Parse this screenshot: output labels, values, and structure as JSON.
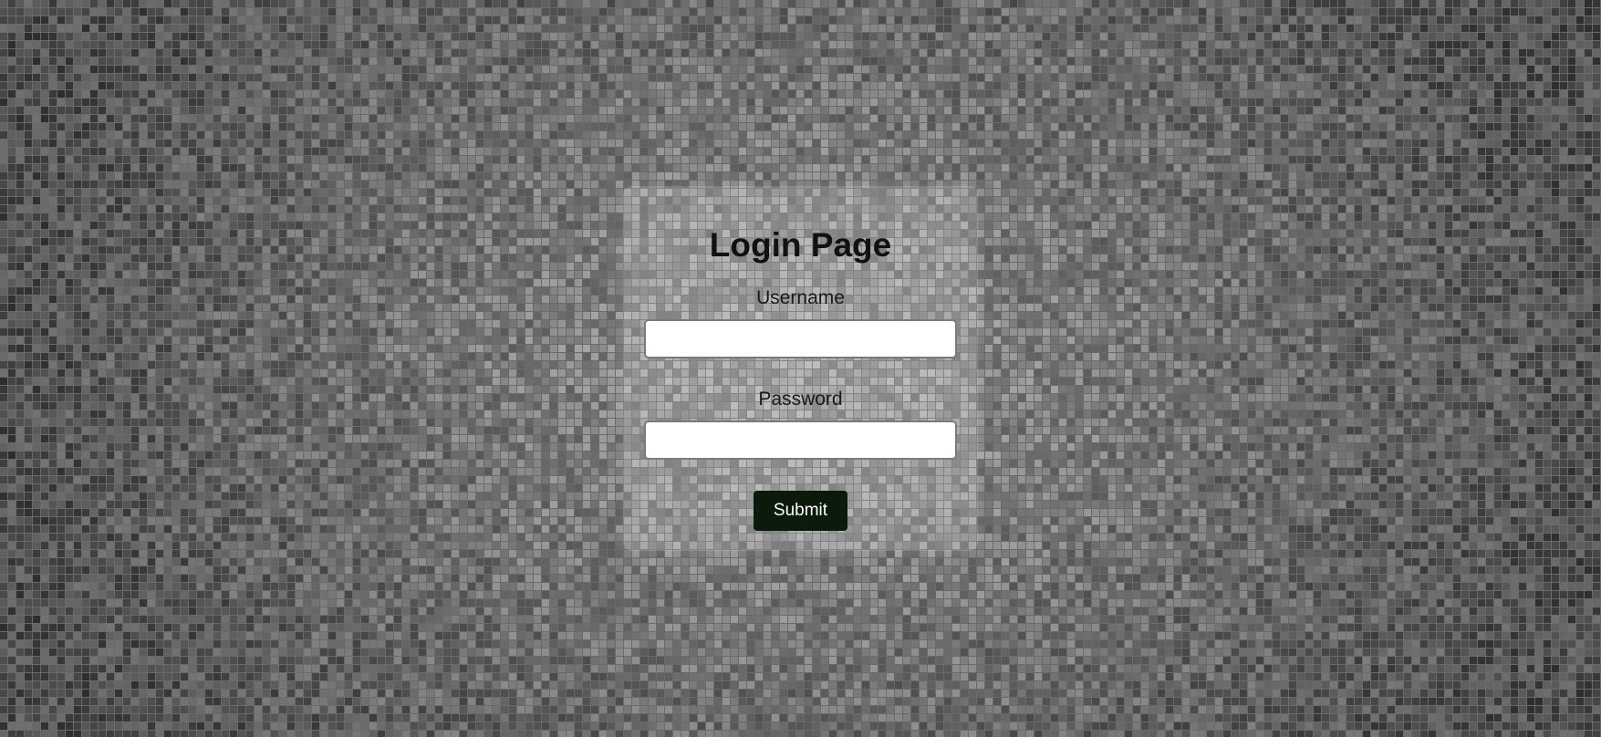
{
  "login": {
    "title": "Login Page",
    "username_label": "Username",
    "username_value": "",
    "password_label": "Password",
    "password_value": "",
    "submit_label": "Submit"
  },
  "colors": {
    "background": "#6a6a6a",
    "submit_button": "#0b1a0b",
    "submit_text": "#ffffff"
  }
}
